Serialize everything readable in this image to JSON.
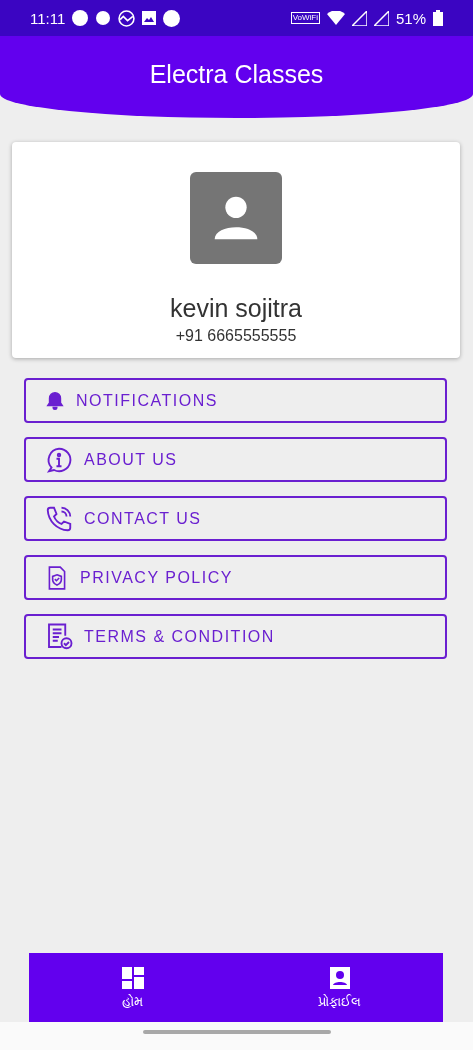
{
  "status_bar": {
    "time": "11:11",
    "network_badge": "VoWiFi",
    "battery": "51%"
  },
  "header": {
    "title": "Electra Classes"
  },
  "profile": {
    "name": "kevin sojitra",
    "phone": "+91 6665555555"
  },
  "menu": [
    {
      "kind": "bell",
      "label": "NOTIFICATIONS"
    },
    {
      "kind": "info",
      "label": "ABOUT US"
    },
    {
      "kind": "phone",
      "label": "CONTACT US"
    },
    {
      "kind": "shield",
      "label": "PRIVACY POLICY"
    },
    {
      "kind": "document",
      "label": "TERMS & CONDITION"
    }
  ],
  "bottom_nav": [
    {
      "kind": "dashboard",
      "label": "હોમ"
    },
    {
      "kind": "profile",
      "label": "પ્રોફાઈલ"
    }
  ]
}
